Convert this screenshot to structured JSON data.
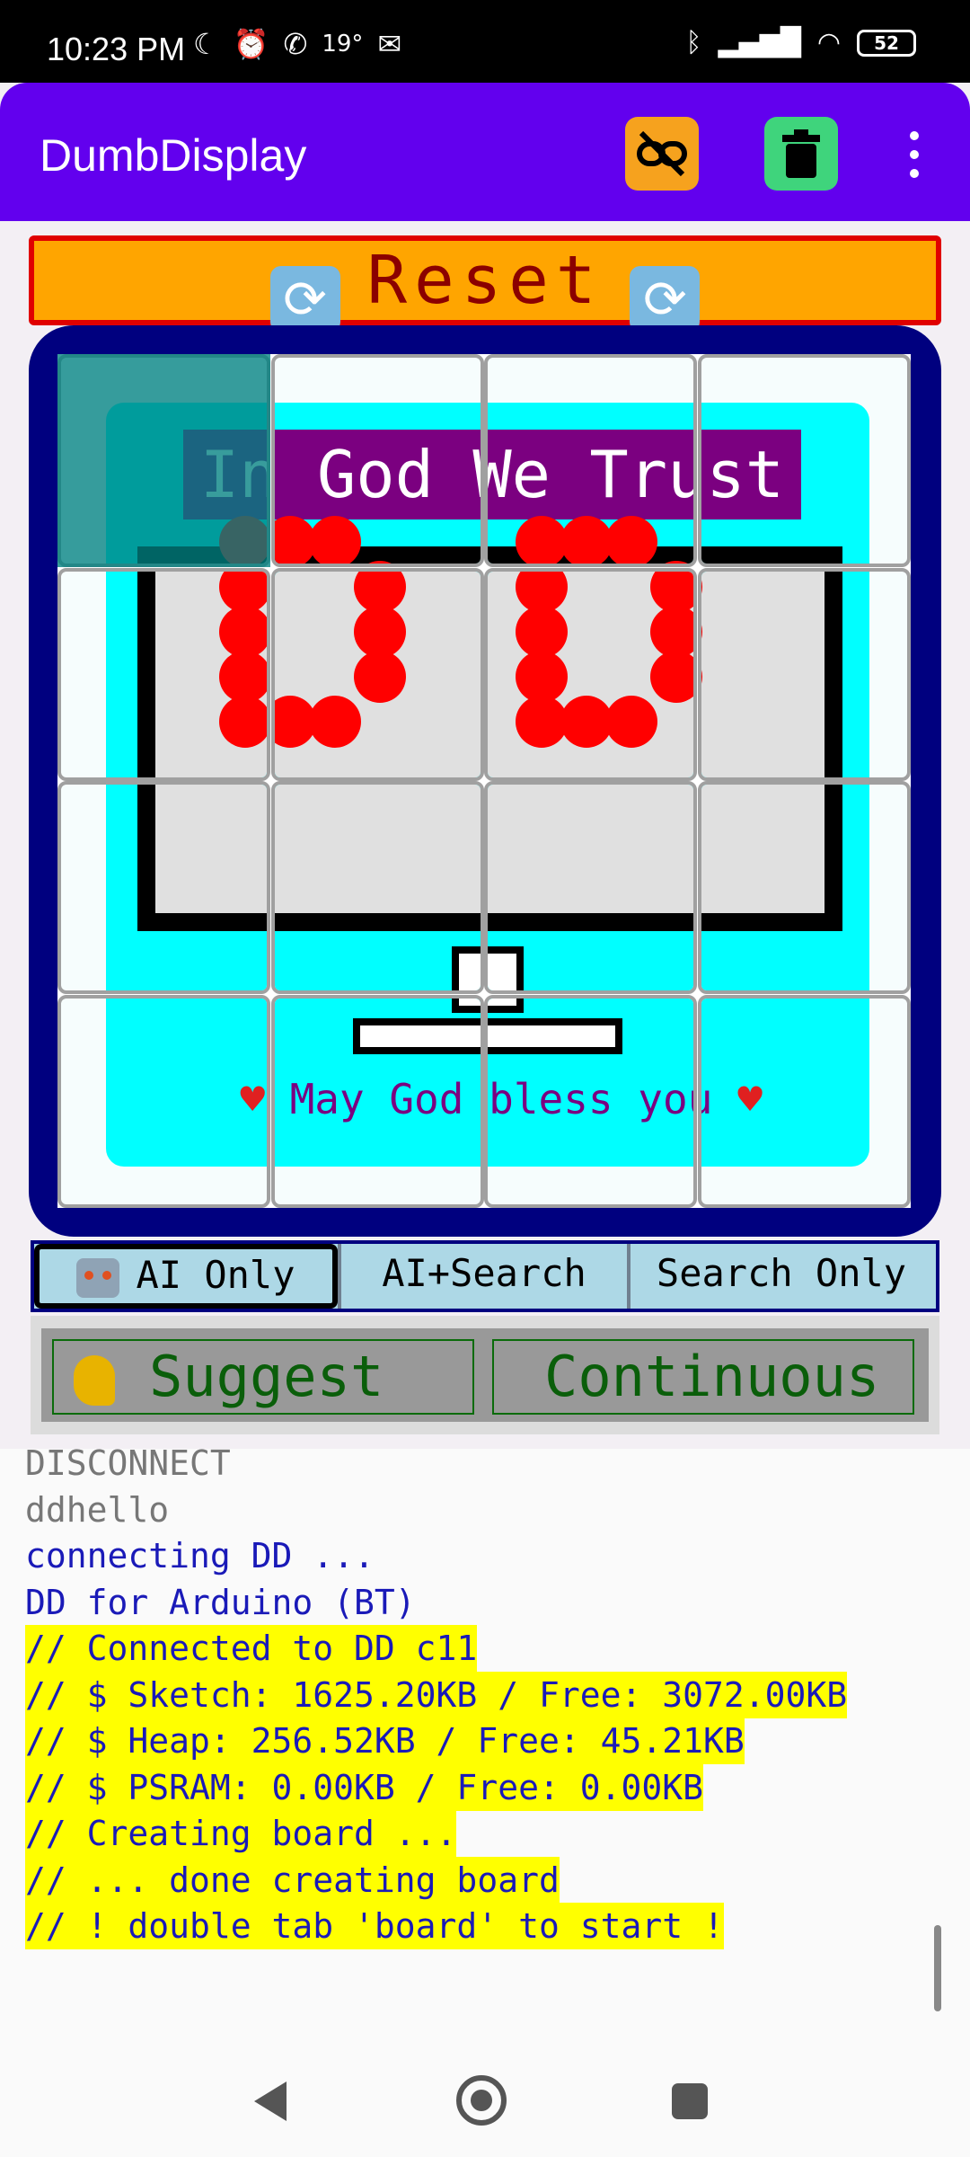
{
  "status_bar": {
    "time": "10:23 PM",
    "temperature": "19°",
    "battery": "52"
  },
  "app_bar": {
    "title": "DumbDisplay",
    "icons": [
      "unlink-icon",
      "trash-icon",
      "more-vert-icon"
    ]
  },
  "reset": {
    "label": "Reset"
  },
  "board": {
    "banner": "God We Trust",
    "banner_hidden_part": "In ",
    "footer_text": "May God bless you"
  },
  "modes": {
    "items": [
      "AI Only",
      "AI+Search",
      "Search Only"
    ],
    "selected": "AI Only"
  },
  "actions": {
    "suggest": "Suggest",
    "continuous": "Continuous"
  },
  "log": [
    {
      "text": "DISCONNECT",
      "style": "gray"
    },
    {
      "text": "ddhello",
      "style": "gray"
    },
    {
      "text": "connecting DD ...",
      "style": "blue"
    },
    {
      "text": "DD for Arduino (BT)",
      "style": "blue"
    },
    {
      "text": "// Connected to DD c11",
      "style": "hl"
    },
    {
      "text": "// $ Sketch: 1625.20KB / Free: 3072.00KB",
      "style": "hl"
    },
    {
      "text": "// $ Heap: 256.52KB / Free: 45.21KB",
      "style": "hl"
    },
    {
      "text": "// $ PSRAM: 0.00KB / Free: 0.00KB",
      "style": "hl"
    },
    {
      "text": "// Creating board ...",
      "style": "hl"
    },
    {
      "text": "// ... done creating board",
      "style": "hl"
    },
    {
      "text": "// ! double tab 'board' to start !",
      "style": "hl"
    }
  ]
}
